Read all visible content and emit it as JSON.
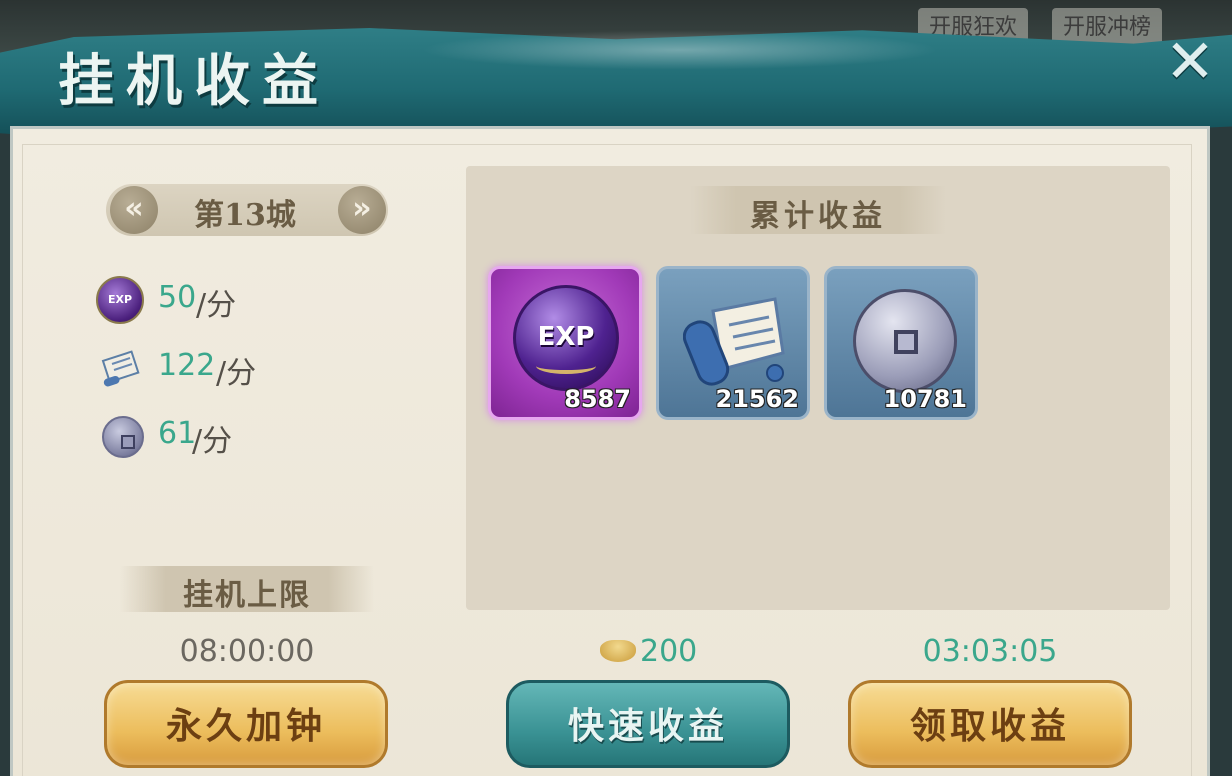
{
  "background_tabs": [
    "开服狂欢",
    "开服冲榜"
  ],
  "header": {
    "title": "挂机收益",
    "close_symbol": "✕"
  },
  "city": {
    "prev_symbol": "«",
    "name": "第13城",
    "next_symbol": "»"
  },
  "rates": [
    {
      "icon": "exp-orb-icon",
      "value": "50",
      "unit": "/分"
    },
    {
      "icon": "scroll-icon",
      "value": "122",
      "unit": "/分"
    },
    {
      "icon": "coin-icon",
      "value": "61",
      "unit": "/分"
    }
  ],
  "accumulated": {
    "title": "累计收益",
    "items": [
      {
        "icon": "exp-orb-icon",
        "label": "EXP",
        "count": "8587",
        "rarity": "purple"
      },
      {
        "icon": "scroll-icon",
        "count": "21562",
        "rarity": "blue"
      },
      {
        "icon": "coin-icon",
        "count": "10781",
        "rarity": "blue"
      }
    ]
  },
  "limit": {
    "title": "挂机上限",
    "time": "08:00:00"
  },
  "quick": {
    "cost": "200",
    "cost_icon": "gold-ingot-icon"
  },
  "timer": "03:03:05",
  "buttons": {
    "permanent": "永久加钟",
    "quick": "快速收益",
    "claim": "领取收益"
  },
  "colors": {
    "accent_green": "#3aa78c",
    "header_teal": "#1f6a73",
    "gold_button": "#ecbd5c",
    "teal_button": "#3a9294",
    "rare_purple": "#a13ab8"
  }
}
